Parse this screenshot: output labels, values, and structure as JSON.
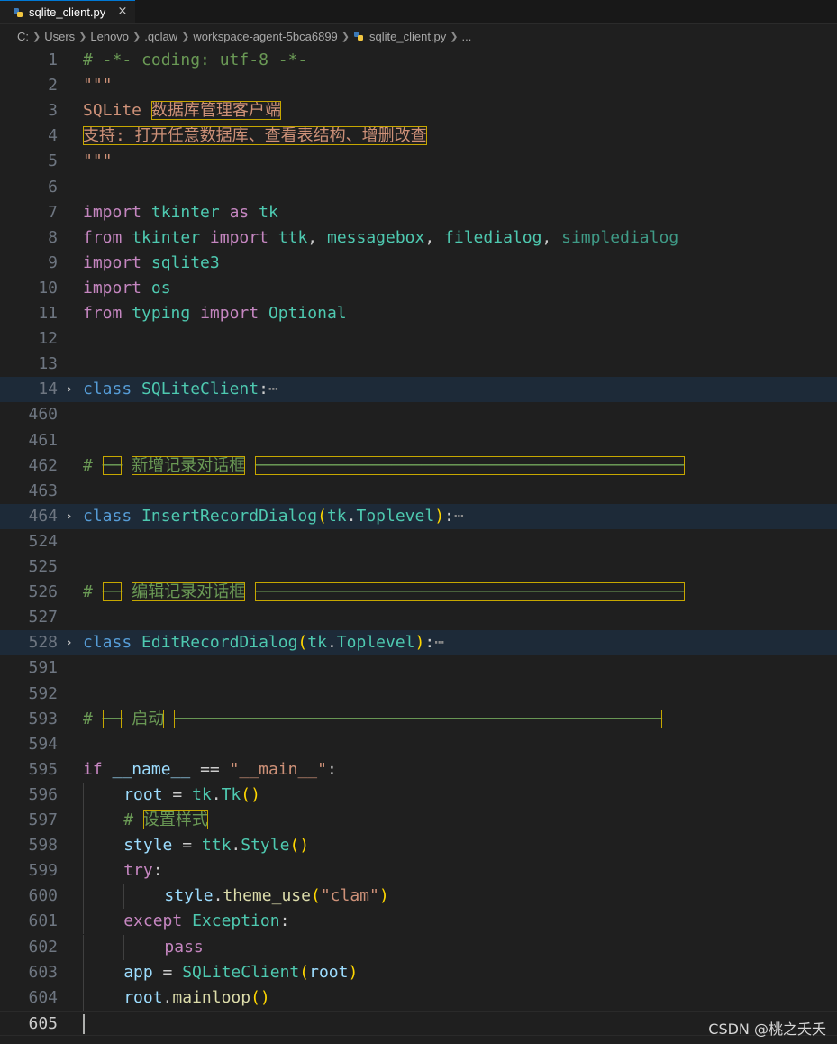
{
  "tab": {
    "file_name": "sqlite_client.py",
    "close_symbol": "×",
    "active_border_color": "#0078d4"
  },
  "breadcrumb": [
    "C:",
    "Users",
    "Lenovo",
    ".qclaw",
    "workspace-agent-5bca6899",
    "sqlite_client.py",
    "..."
  ],
  "colors": {
    "background": "#1f1f1f",
    "keyword": "#c586c0",
    "class_keyword": "#569cd6",
    "class_name": "#4ec9b0",
    "string": "#ce9178",
    "comment": "#6a9955",
    "variable": "#9cdcfe",
    "function": "#dcdcaa",
    "folded_line_highlight": "#1d2a38"
  },
  "lines": [
    {
      "n": "1",
      "tokens": [
        {
          "t": "# -*- coding: utf-8 -*-",
          "c": "cmt"
        }
      ]
    },
    {
      "n": "2",
      "tokens": [
        {
          "t": "\"\"\"",
          "c": "str"
        }
      ]
    },
    {
      "n": "3",
      "tokens": [
        {
          "t": "SQLite ",
          "c": "str"
        },
        {
          "t": "数据库管理客户端",
          "c": "str",
          "box": true
        }
      ]
    },
    {
      "n": "4",
      "tokens": [
        {
          "t": "支持: 打开任意数据库、查看表结构、增删改查",
          "c": "str",
          "box": true
        }
      ]
    },
    {
      "n": "5",
      "tokens": [
        {
          "t": "\"\"\"",
          "c": "str"
        }
      ]
    },
    {
      "n": "6",
      "tokens": []
    },
    {
      "n": "7",
      "tokens": [
        {
          "t": "import",
          "c": "kw"
        },
        {
          "t": " "
        },
        {
          "t": "tkinter",
          "c": "cls"
        },
        {
          "t": " "
        },
        {
          "t": "as",
          "c": "kw"
        },
        {
          "t": " "
        },
        {
          "t": "tk",
          "c": "cls"
        }
      ]
    },
    {
      "n": "8",
      "tokens": [
        {
          "t": "from",
          "c": "kw"
        },
        {
          "t": " "
        },
        {
          "t": "tkinter",
          "c": "cls"
        },
        {
          "t": " "
        },
        {
          "t": "import",
          "c": "kw"
        },
        {
          "t": " "
        },
        {
          "t": "ttk",
          "c": "cls"
        },
        {
          "t": ", "
        },
        {
          "t": "messagebox",
          "c": "cls"
        },
        {
          "t": ", "
        },
        {
          "t": "filedialog",
          "c": "cls"
        },
        {
          "t": ", "
        },
        {
          "t": "simpledialog",
          "c": "dim"
        }
      ]
    },
    {
      "n": "9",
      "tokens": [
        {
          "t": "import",
          "c": "kw"
        },
        {
          "t": " "
        },
        {
          "t": "sqlite3",
          "c": "cls"
        }
      ]
    },
    {
      "n": "10",
      "tokens": [
        {
          "t": "import",
          "c": "kw"
        },
        {
          "t": " "
        },
        {
          "t": "os",
          "c": "cls"
        }
      ]
    },
    {
      "n": "11",
      "tokens": [
        {
          "t": "from",
          "c": "kw"
        },
        {
          "t": " "
        },
        {
          "t": "typing",
          "c": "cls"
        },
        {
          "t": " "
        },
        {
          "t": "import",
          "c": "kw"
        },
        {
          "t": " "
        },
        {
          "t": "Optional",
          "c": "cls"
        }
      ]
    },
    {
      "n": "12",
      "tokens": []
    },
    {
      "n": "13",
      "tokens": []
    },
    {
      "n": "14",
      "fold": true,
      "hl": true,
      "tokens": [
        {
          "t": "class",
          "c": "kw2"
        },
        {
          "t": " "
        },
        {
          "t": "SQLiteClient",
          "c": "cls"
        },
        {
          "t": ":"
        },
        {
          "t": "⋯",
          "c": "ell"
        }
      ]
    },
    {
      "n": "460",
      "tokens": []
    },
    {
      "n": "461",
      "tokens": []
    },
    {
      "n": "462",
      "tokens": [
        {
          "t": "# ",
          "c": "cmt"
        },
        {
          "t": "──",
          "c": "cmt",
          "box": true
        },
        {
          "t": " ",
          "c": "cmt"
        },
        {
          "t": "新增记录对话框",
          "c": "cmt",
          "box": true
        },
        {
          "t": " ",
          "c": "cmt"
        },
        {
          "t": "────────────────────────────────────────────",
          "c": "cmt",
          "box": true
        }
      ]
    },
    {
      "n": "463",
      "tokens": []
    },
    {
      "n": "464",
      "fold": true,
      "hl": true,
      "tokens": [
        {
          "t": "class",
          "c": "kw2"
        },
        {
          "t": " "
        },
        {
          "t": "InsertRecordDialog",
          "c": "cls"
        },
        {
          "t": "(",
          "c": "p1"
        },
        {
          "t": "tk",
          "c": "cls"
        },
        {
          "t": "."
        },
        {
          "t": "Toplevel",
          "c": "cls"
        },
        {
          "t": ")",
          "c": "p1"
        },
        {
          "t": ":"
        },
        {
          "t": "⋯",
          "c": "ell"
        }
      ]
    },
    {
      "n": "524",
      "tokens": []
    },
    {
      "n": "525",
      "tokens": []
    },
    {
      "n": "526",
      "tokens": [
        {
          "t": "# ",
          "c": "cmt"
        },
        {
          "t": "──",
          "c": "cmt",
          "box": true
        },
        {
          "t": " ",
          "c": "cmt"
        },
        {
          "t": "编辑记录对话框",
          "c": "cmt",
          "box": true
        },
        {
          "t": " ",
          "c": "cmt"
        },
        {
          "t": "────────────────────────────────────────────",
          "c": "cmt",
          "box": true
        }
      ]
    },
    {
      "n": "527",
      "tokens": []
    },
    {
      "n": "528",
      "fold": true,
      "hl": true,
      "tokens": [
        {
          "t": "class",
          "c": "kw2"
        },
        {
          "t": " "
        },
        {
          "t": "EditRecordDialog",
          "c": "cls"
        },
        {
          "t": "(",
          "c": "p1"
        },
        {
          "t": "tk",
          "c": "cls"
        },
        {
          "t": "."
        },
        {
          "t": "Toplevel",
          "c": "cls"
        },
        {
          "t": ")",
          "c": "p1"
        },
        {
          "t": ":"
        },
        {
          "t": "⋯",
          "c": "ell"
        }
      ]
    },
    {
      "n": "591",
      "tokens": []
    },
    {
      "n": "592",
      "tokens": []
    },
    {
      "n": "593",
      "tokens": [
        {
          "t": "# ",
          "c": "cmt"
        },
        {
          "t": "──",
          "c": "cmt",
          "box": true
        },
        {
          "t": " ",
          "c": "cmt"
        },
        {
          "t": "启动",
          "c": "cmt",
          "box": true
        },
        {
          "t": " ",
          "c": "cmt"
        },
        {
          "t": "──────────────────────────────────────────────────",
          "c": "cmt",
          "box": true
        }
      ]
    },
    {
      "n": "594",
      "tokens": []
    },
    {
      "n": "595",
      "tokens": [
        {
          "t": "if",
          "c": "kw"
        },
        {
          "t": " "
        },
        {
          "t": "__name__",
          "c": "var"
        },
        {
          "t": " == "
        },
        {
          "t": "\"__main__\"",
          "c": "str"
        },
        {
          "t": ":"
        }
      ]
    },
    {
      "n": "596",
      "indent": 1,
      "tokens": [
        {
          "t": "root",
          "c": "var"
        },
        {
          "t": " = "
        },
        {
          "t": "tk",
          "c": "cls"
        },
        {
          "t": "."
        },
        {
          "t": "Tk",
          "c": "cls"
        },
        {
          "t": "()",
          "c": "p1"
        }
      ]
    },
    {
      "n": "597",
      "indent": 1,
      "tokens": [
        {
          "t": "# ",
          "c": "cmt"
        },
        {
          "t": "设置样式",
          "c": "cmt",
          "box": true
        }
      ]
    },
    {
      "n": "598",
      "indent": 1,
      "tokens": [
        {
          "t": "style",
          "c": "var"
        },
        {
          "t": " = "
        },
        {
          "t": "ttk",
          "c": "cls"
        },
        {
          "t": "."
        },
        {
          "t": "Style",
          "c": "cls"
        },
        {
          "t": "()",
          "c": "p1"
        }
      ]
    },
    {
      "n": "599",
      "indent": 1,
      "tokens": [
        {
          "t": "try",
          "c": "kw"
        },
        {
          "t": ":"
        }
      ]
    },
    {
      "n": "600",
      "indent": 2,
      "tokens": [
        {
          "t": "style",
          "c": "var"
        },
        {
          "t": "."
        },
        {
          "t": "theme_use",
          "c": "fn"
        },
        {
          "t": "(",
          "c": "p1"
        },
        {
          "t": "\"clam\"",
          "c": "str"
        },
        {
          "t": ")",
          "c": "p1"
        }
      ]
    },
    {
      "n": "601",
      "indent": 1,
      "tokens": [
        {
          "t": "except",
          "c": "kw"
        },
        {
          "t": " "
        },
        {
          "t": "Exception",
          "c": "cls"
        },
        {
          "t": ":"
        }
      ]
    },
    {
      "n": "602",
      "indent": 2,
      "tokens": [
        {
          "t": "pass",
          "c": "kw"
        }
      ]
    },
    {
      "n": "603",
      "indent": 1,
      "tokens": [
        {
          "t": "app",
          "c": "var"
        },
        {
          "t": " = "
        },
        {
          "t": "SQLiteClient",
          "c": "cls"
        },
        {
          "t": "(",
          "c": "p1"
        },
        {
          "t": "root",
          "c": "var"
        },
        {
          "t": ")",
          "c": "p1"
        }
      ]
    },
    {
      "n": "604",
      "indent": 1,
      "tokens": [
        {
          "t": "root",
          "c": "var"
        },
        {
          "t": "."
        },
        {
          "t": "mainloop",
          "c": "fn"
        },
        {
          "t": "()",
          "c": "p1"
        }
      ]
    },
    {
      "n": "605",
      "active": true,
      "tokens": []
    }
  ],
  "watermark": "CSDN @桃之夭夭"
}
